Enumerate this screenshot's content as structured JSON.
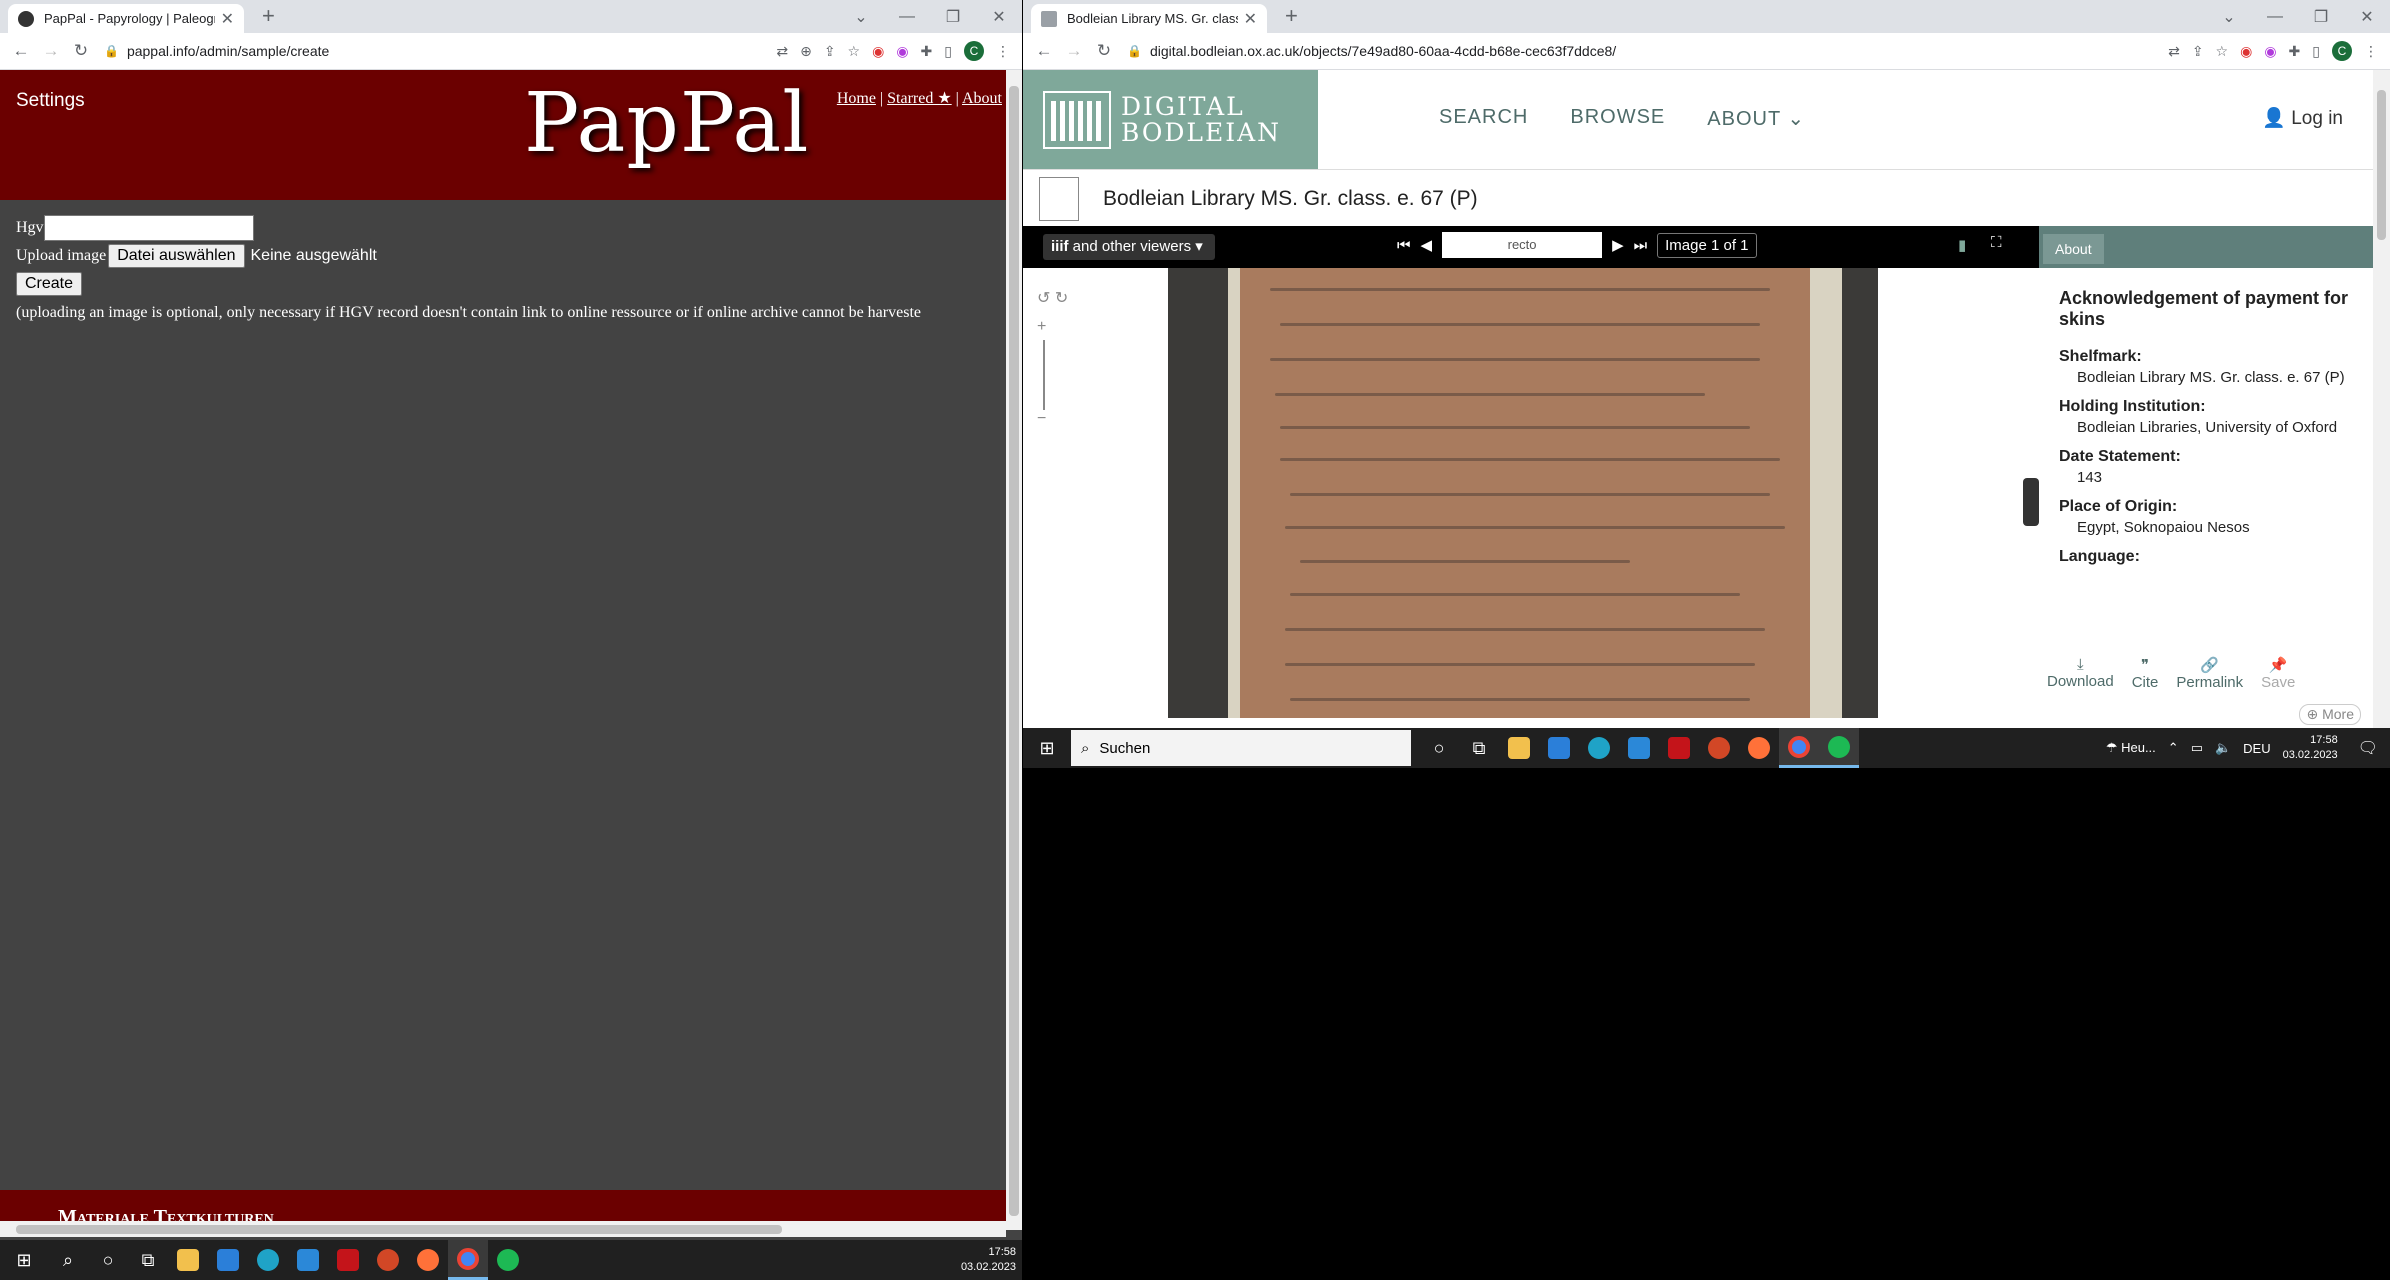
{
  "left_browser": {
    "tab_title": "PapPal - Papyrology | Paleograph",
    "url": "pappal.info/admin/sample/create",
    "profile_letter": "C",
    "page": {
      "settings_label": "Settings",
      "logo_text": "PapPal",
      "nav": {
        "home": "Home",
        "sep1": "|",
        "starred": "Starred ★",
        "sep2": "|",
        "about": "About"
      },
      "form": {
        "hgv_label": "Hgv",
        "hgv_value": "",
        "upload_label": "Upload image",
        "file_button": "Datei auswählen",
        "file_status": "Keine ausgewählt",
        "create_button": "Create",
        "note": "(uploading an image is optional, only necessary if HGV record doesn't contain link to online ressource or if online archive cannot be harveste"
      },
      "footer_text": "Materiale Textkulturen"
    }
  },
  "right_browser": {
    "tab_title": "Bodleian Library MS. Gr. class. e.",
    "url": "digital.bodleian.ox.ac.uk/objects/7e49ad80-60aa-4cdd-b68e-cec63f7ddce8/",
    "profile_letter": "C",
    "header": {
      "logo_line1": "DIGITAL",
      "logo_line2": "BODLEIAN",
      "nav": {
        "search": "SEARCH",
        "browse": "BROWSE",
        "about": "ABOUT"
      },
      "login": "Log in"
    },
    "object_title": "Bodleian Library MS. Gr. class. e. 67 (P)",
    "viewer": {
      "viewers_dropdown": "and other viewers",
      "page_input": "recto",
      "image_count": "Image 1 of 1"
    },
    "panel": {
      "tab": "About",
      "heading": "Acknowledgement of payment for skins",
      "fields": [
        {
          "label": "Shelfmark:",
          "value": "Bodleian Library MS. Gr. class. e. 67 (P)"
        },
        {
          "label": "Holding Institution:",
          "value": "Bodleian Libraries, University of Oxford"
        },
        {
          "label": "Date Statement:",
          "value": "143"
        },
        {
          "label": "Place of Origin:",
          "value": "Egypt, Soknopaiou Nesos"
        },
        {
          "label": "Language:",
          "value": ""
        }
      ],
      "actions": {
        "download": "Download",
        "cite": "Cite",
        "permalink": "Permalink",
        "save": "Save"
      },
      "more": "More"
    }
  },
  "taskbar_right": {
    "search_placeholder": "Suchen",
    "weather": "Heu...",
    "lang": "DEU",
    "time": "17:58",
    "date": "03.02.2023"
  },
  "taskbar_left": {
    "time": "17:58",
    "date": "03.02.2023"
  },
  "colors": {
    "pappal_red": "#6b0000",
    "bodleian_green": "#7fa89a"
  }
}
